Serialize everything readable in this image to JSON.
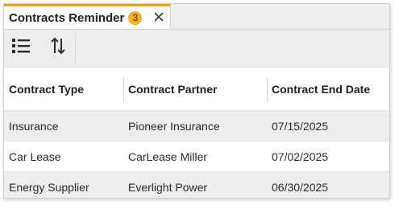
{
  "panel": {
    "tab_title": "Contracts Reminder",
    "badge_count": "3",
    "close_icon": "close-icon"
  },
  "toolbar": {
    "buttons": [
      {
        "icon": "list-view-icon"
      },
      {
        "icon": "sort-icon"
      }
    ]
  },
  "table": {
    "headers": [
      "Contract Type",
      "Contract Partner",
      "Contract End Date"
    ],
    "rows": [
      [
        "Insurance",
        "Pioneer Insurance",
        "07/15/2025"
      ],
      [
        "Car Lease",
        "CarLease Miller",
        "07/02/2025"
      ],
      [
        "Energy Supplier",
        "Everlight Power",
        "06/30/2025"
      ]
    ]
  },
  "colors": {
    "accent": "#f0a40a",
    "badge": "#f2b01e",
    "alt_row": "#eeeeee"
  }
}
